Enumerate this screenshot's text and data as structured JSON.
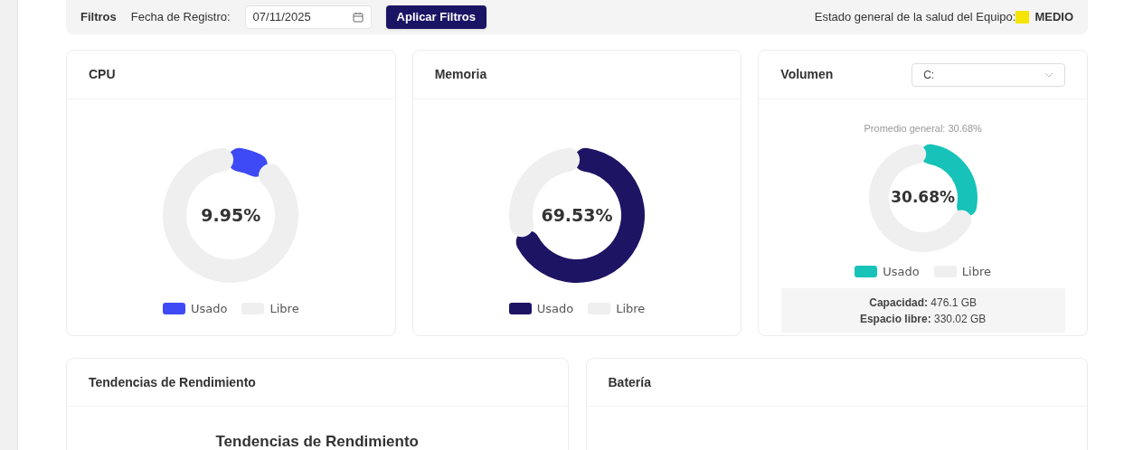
{
  "filters": {
    "title": "Filtros",
    "date_label": "Fecha de Registro:",
    "date_value": "07/11/2025",
    "apply_button": "Aplicar Filtros",
    "health": {
      "label": "Estado general de la salud del Equipo:",
      "color": "#f5e400",
      "value": "MEDIO"
    }
  },
  "cards": [
    {
      "title": "CPU",
      "center_label": "9.95%",
      "chart_data": {
        "type": "donut",
        "categories": [
          "Usado",
          "Libre"
        ],
        "series": [
          {
            "values": [
              9.95,
              90.05
            ]
          }
        ]
      },
      "legend": [
        {
          "color": "#3d4af5"
        },
        {
          "color": "#efefef"
        }
      ]
    },
    {
      "title": "Memoria",
      "center_label": "69.53%",
      "chart_data": {
        "type": "donut",
        "categories": [
          "Usado",
          "Libre"
        ],
        "series": [
          {
            "values": [
              69.53,
              30.47
            ]
          }
        ]
      },
      "legend": [
        {
          "color": "#1e1464"
        },
        {
          "color": "#efefef"
        }
      ]
    }
  ],
  "volume": {
    "title": "Volumen",
    "drive": "C:",
    "average": "Promedio general: 30.68%",
    "center_label": "30.68%",
    "chart_data": {
      "type": "donut",
      "categories": [
        "Usado",
        "Libre"
      ],
      "series": [
        {
          "values": [
            30.68,
            69.32
          ]
        }
      ]
    },
    "legend": [
      {
        "color": "#17c3b8"
      },
      {
        "color": "#efefef"
      }
    ],
    "capacity_label": "Capacidad:",
    "capacity_value": "476.1 GB",
    "free_label": "Espacio libre:",
    "free_value": "330.02 GB"
  },
  "trends": {
    "title": "Tendencias de Rendimiento",
    "chart_title": "Tendencias de Rendimiento"
  },
  "battery": {
    "title": "Batería"
  }
}
